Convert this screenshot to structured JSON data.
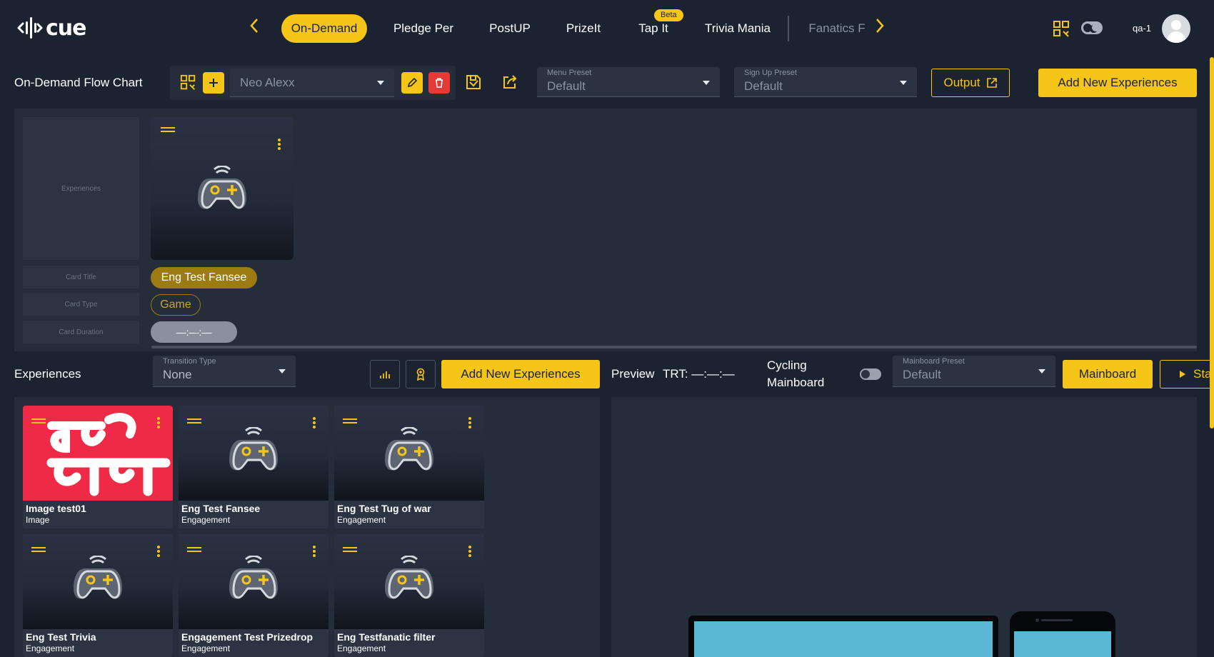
{
  "brand": {
    "name": "cue"
  },
  "nav": {
    "tabs": [
      {
        "label": "On-Demand",
        "active": true
      },
      {
        "label": "Pledge Per"
      },
      {
        "label": "PostUP"
      },
      {
        "label": "PrizeIt"
      },
      {
        "label": "Tap It",
        "badge": "Beta"
      },
      {
        "label": "Trivia Mania"
      },
      {
        "label": "Fanatics F",
        "faded": true
      }
    ],
    "user": "qa-1"
  },
  "toolbar": {
    "title": "On-Demand Flow Chart",
    "flow_select": "Neo Alexx",
    "menu_preset": {
      "label": "Menu Preset",
      "value": "Default"
    },
    "signup_preset": {
      "label": "Sign Up Preset",
      "value": "Default"
    },
    "output_label": "Output",
    "add_label": "Add New Experiences"
  },
  "flow": {
    "placeholders": {
      "experiences": "Experiences",
      "card_title": "Card Title",
      "card_type": "Card Type",
      "card_duration": "Card Duration"
    },
    "card": {
      "title": "Eng Test Fansee",
      "type": "Game",
      "duration": "—:—:—"
    }
  },
  "experiences": {
    "title": "Experiences",
    "transition": {
      "label": "Transition Type",
      "value": "None"
    },
    "add_label": "Add New Experiences",
    "items": [
      {
        "title": "Image test01",
        "type": "Image",
        "image": true
      },
      {
        "title": "Eng Test Fansee",
        "type": "Engagement"
      },
      {
        "title": "Eng Test Tug of war",
        "type": "Engagement"
      },
      {
        "title": "Eng Test Trivia",
        "type": "Engagement"
      },
      {
        "title": "Engagement Test Prizedrop",
        "type": "Engagement"
      },
      {
        "title": "Eng Testfanatic filter",
        "type": "Engagement"
      }
    ]
  },
  "preview": {
    "label": "Preview",
    "trt": "TRT: —:—:—",
    "cycling": "Cycling Mainboard",
    "cycling_on": false,
    "mainboard_preset": {
      "label": "Mainboard Preset",
      "value": "Default"
    },
    "mainboard_label": "Mainboard",
    "start_label": "Sta"
  },
  "colors": {
    "accent": "#f5c518",
    "bg": "#1b2230",
    "panel": "#252d3b",
    "danger": "#e53935",
    "screen": "#5bb8d4"
  }
}
